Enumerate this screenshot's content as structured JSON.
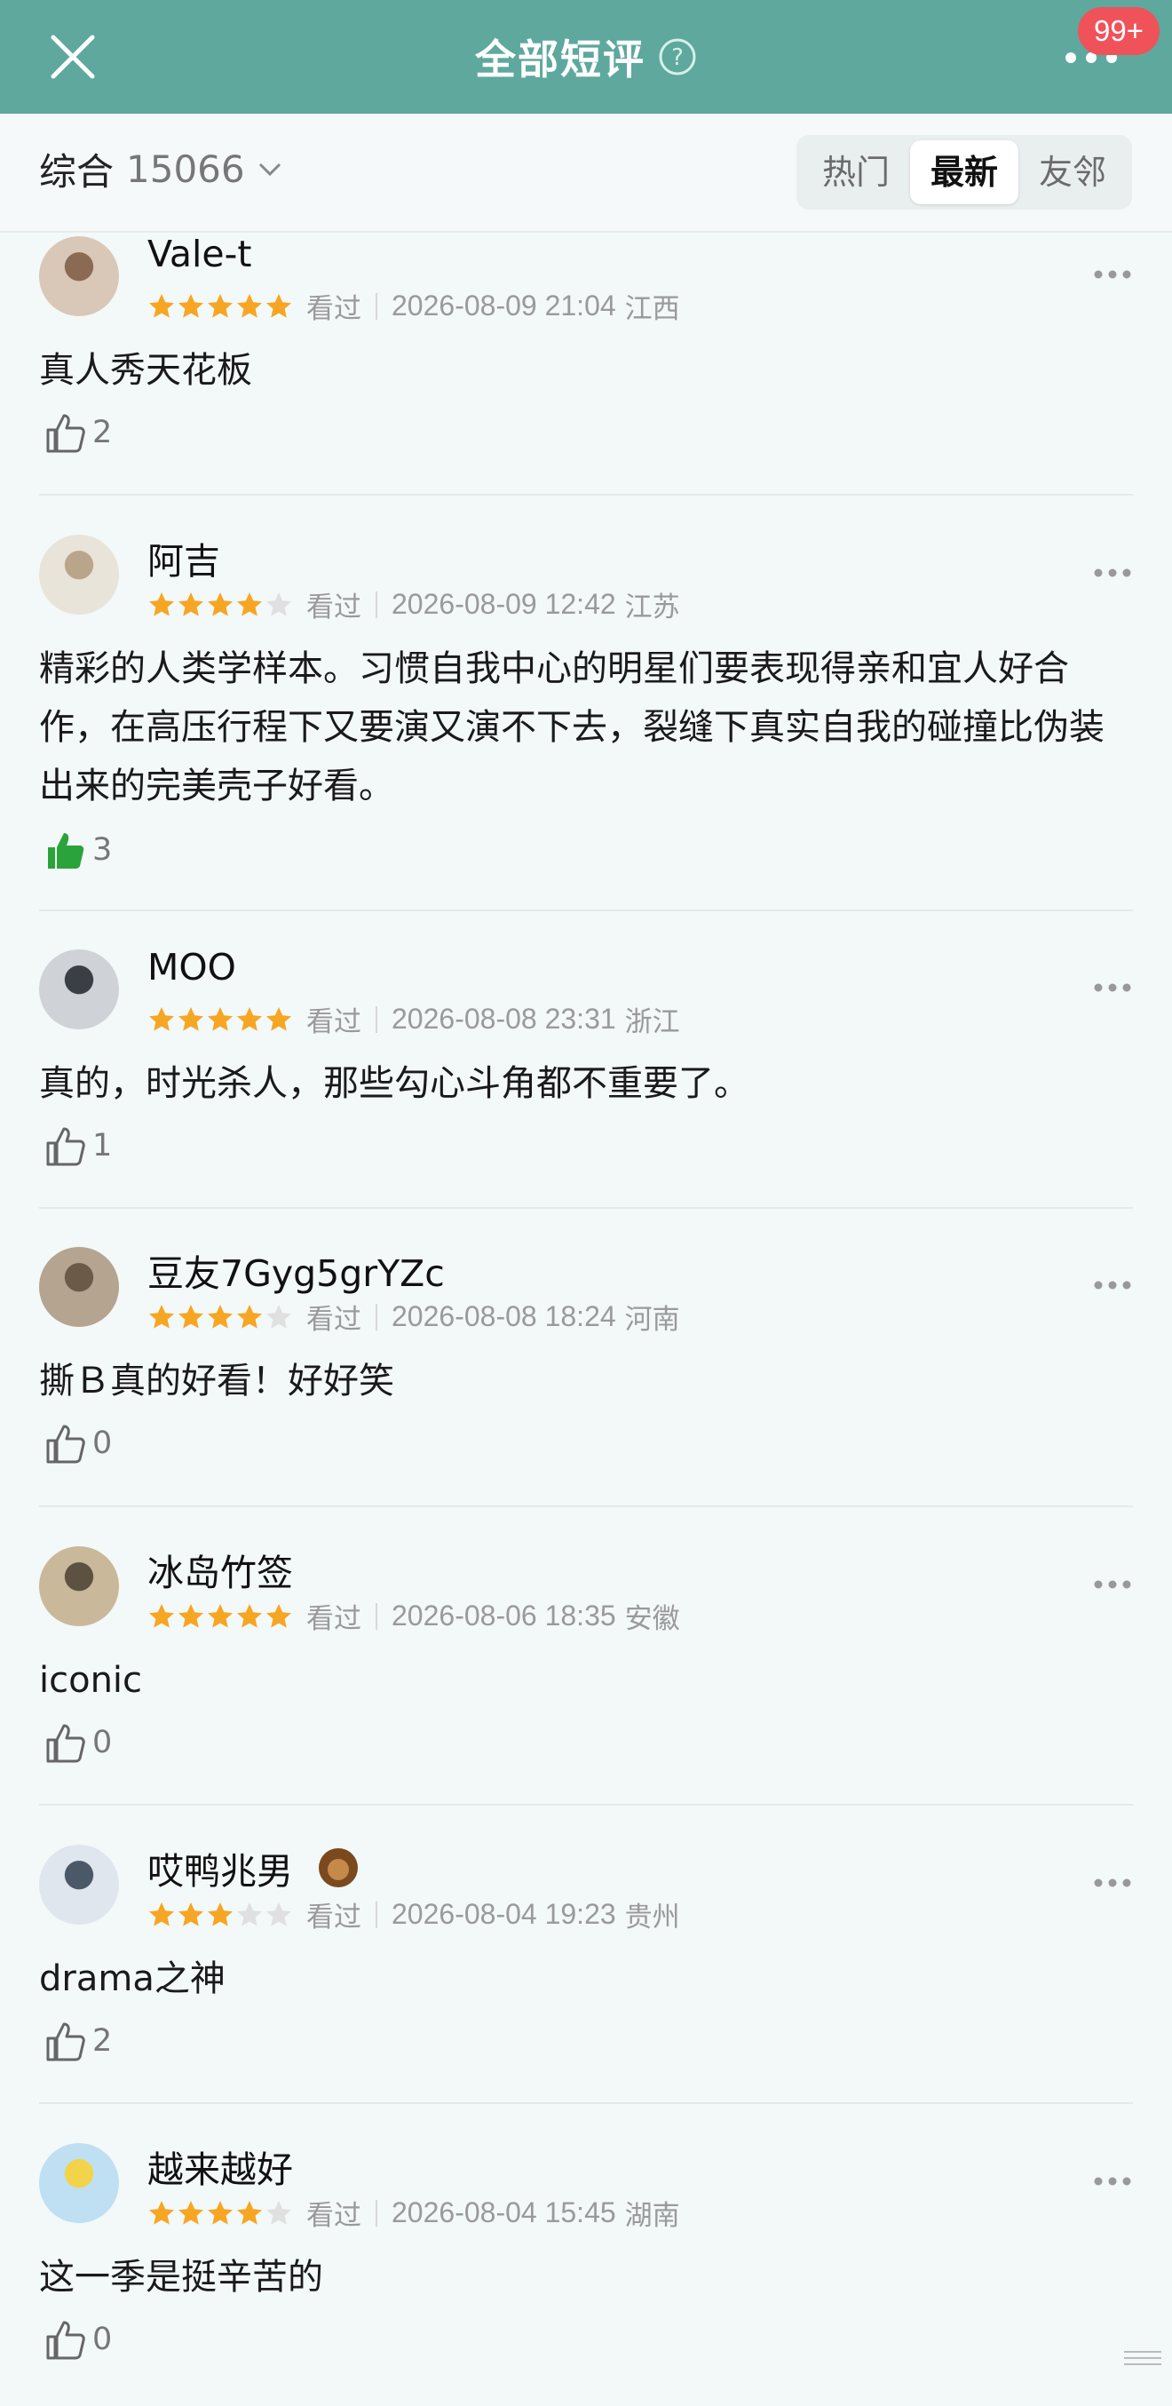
{
  "header": {
    "title": "全部短评",
    "badge": "99+",
    "icons": {
      "close": "close-icon",
      "help": "question-circle-icon",
      "more": "more-horizontal-icon"
    }
  },
  "filter": {
    "sort_label": "综合",
    "count": "15066",
    "tabs": [
      "热门",
      "最新",
      "友邻"
    ],
    "active_tab": "最新"
  },
  "colors": {
    "header_bg": "#5ea89e",
    "star_on": "#f6a623",
    "star_off": "#e0e0e0",
    "liked_green": "#2aa33a",
    "badge_red": "#f0525a"
  },
  "watched_label": "看过",
  "reviews": [
    {
      "user": "Vale-t",
      "stars": 5,
      "watched": "看过",
      "datetime": "2026-08-09 21:04",
      "location": "江西",
      "text": "真人秀天花板",
      "likes": "2",
      "liked": false
    },
    {
      "user": "阿吉",
      "stars": 4,
      "watched": "看过",
      "datetime": "2026-08-09 12:42",
      "location": "江苏",
      "text": "精彩的人类学样本。习惯自我中心的明星们要表现得亲和宜人好合作，在高压行程下又要演又演不下去，裂缝下真实自我的碰撞比伪装出来的完美壳子好看。",
      "likes": "3",
      "liked": true
    },
    {
      "user": "MOO",
      "stars": 5,
      "watched": "看过",
      "datetime": "2026-08-08 23:31",
      "location": "浙江",
      "text": "真的，时光杀人，那些勾心斗角都不重要了。",
      "likes": "1",
      "liked": false
    },
    {
      "user": "豆友7Gyg5grYZc",
      "stars": 4,
      "watched": "看过",
      "datetime": "2026-08-08 18:24",
      "location": "河南",
      "text": "撕Ｂ真的好看！好好笑",
      "likes": "0",
      "liked": false
    },
    {
      "user": "冰岛竹签",
      "stars": 5,
      "watched": "看过",
      "datetime": "2026-08-06 18:35",
      "location": "安徽",
      "text": "iconic",
      "likes": "0",
      "liked": false
    },
    {
      "user": "哎鸭兆男",
      "stars": 3,
      "watched": "看过",
      "datetime": "2026-08-04 19:23",
      "location": "贵州",
      "text": "drama之神",
      "likes": "2",
      "liked": false,
      "badge_icon": "lion-badge-icon"
    },
    {
      "user": "越来越好",
      "stars": 4,
      "watched": "看过",
      "datetime": "2026-08-04 15:45",
      "location": "湖南",
      "text": "这一季是挺辛苦的",
      "likes": "0",
      "liked": false
    }
  ]
}
